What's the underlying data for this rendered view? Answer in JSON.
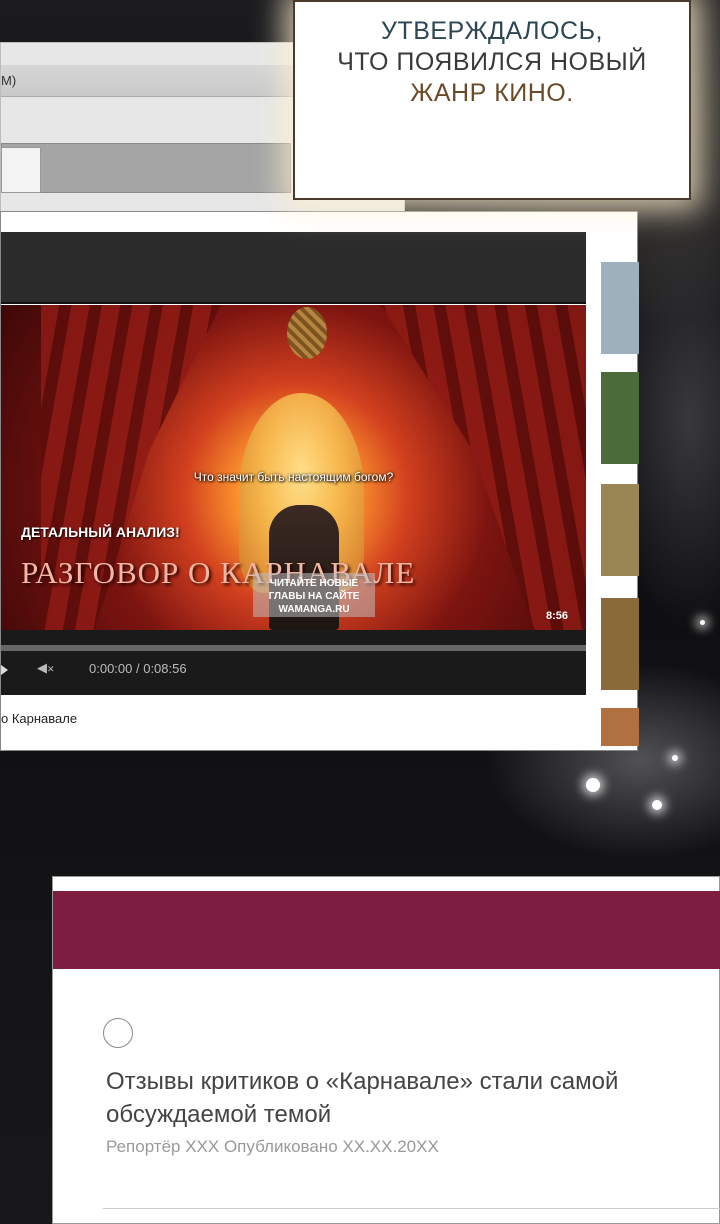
{
  "caption": {
    "lines": [
      "УТВЕРЖДАЛОСЬ,",
      "ЧТО ПОЯВИЛСЯ НОВЫЙ",
      "ЖАНР КИНО."
    ]
  },
  "old_window": {
    "field_text": "M)"
  },
  "video": {
    "subtitle": "Что значит быть настоящим богом?",
    "overlay_label": "ДЕТАЛЬНЫЙ АНАЛИЗ!",
    "overlay_title": "РАЗГОВОР О КАРНАВАЛЕ",
    "watermark_lines": [
      "ЧИТАЙТЕ НОВЫЕ",
      "ГЛАВЫ НА САЙТЕ",
      "WAMANGA.RU"
    ],
    "duration_badge": "8:56",
    "mute_icon": "✕",
    "timecode": "0:00:00 / 0:08:56",
    "progress": 0,
    "title_label": "о Карнавале",
    "thumbnail_colors": [
      "#9fb0bd",
      "#4c6b3a",
      "#9a8654",
      "#8b6a3a",
      "#b0703f"
    ]
  },
  "article": {
    "banner_color": "#7d1d3f",
    "headline": "Отзывы критиков о «Карнавале» стали самой обсуждаемой темой",
    "meta": "Репортёр XXX Опубликовано XX.XX.20XX"
  }
}
